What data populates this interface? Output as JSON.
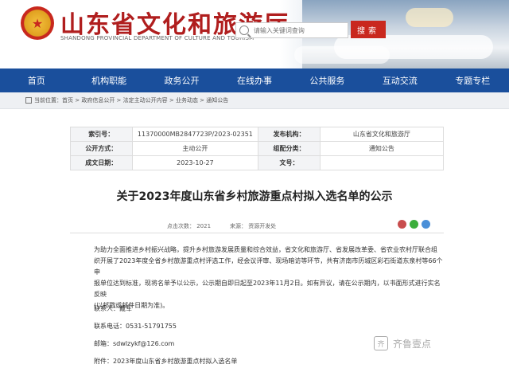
{
  "header": {
    "emblem_glyph": "★",
    "title": "山东省文化和旅游厅",
    "subtitle": "SHANDONG PROVINCIAL DEPARTMENT OF CULTURE AND TOURISM",
    "search_placeholder": "请输入关键词查询",
    "search_button": "搜索"
  },
  "nav": {
    "items": [
      "首页",
      "机构职能",
      "政务公开",
      "在线办事",
      "公共服务",
      "互动交流",
      "专题专栏"
    ]
  },
  "breadcrumb": {
    "prefix": "当前位置：",
    "path": "首页 > 政府信息公开 > 法定主动公开内容 > 业务动态 > 通知公告"
  },
  "info": {
    "rows": [
      {
        "l1": "索引号：",
        "v1": "11370000MB2847723P/2023-02351",
        "l2": "发布机构：",
        "v2": "山东省文化和旅游厅"
      },
      {
        "l1": "公开方式：",
        "v1": "主动公开",
        "l2": "组配分类：",
        "v2": "通知公告"
      },
      {
        "l1": "成文日期：",
        "v1": "2023-10-27",
        "l2": "文号：",
        "v2": ""
      }
    ]
  },
  "article": {
    "title": "关于2023年度山东省乡村旅游重点村拟入选名单的公示",
    "meta_views": "点击次数：  2021",
    "meta_source": "来源：  资源开发处",
    "body_lines": [
      "为助力全面推进乡村振兴战略，提升乡村旅游发展质量和综合效益，省文化和旅游厅、省发展改革委、省农业农村厅联合组",
      "织开展了2023年度全省乡村旅游重点村评选工作，经会议评审、现场暗访等环节，共有济南市历城区彩石街道东泉村等66个申",
      "报单位达到标准，现将名单予以公示，公示期自即日起至2023年11月2日。如有异议，请在公示期内，以书面形式进行实名反映",
      "(以邮戳或邮件日期为准)。"
    ],
    "contact": "联系人：戴军",
    "phone": "联系电话：0531-51791755",
    "email": "邮箱：sdwlzykf@126.com",
    "attachment": "附件：2023年度山东省乡村旅游重点村拟入选名单"
  },
  "watermark": {
    "text": "齐鲁壹点"
  },
  "colors": {
    "nav_bg": "#1a4f9c",
    "title_red": "#b01e1e",
    "search_button_bg": "#c9281e"
  }
}
